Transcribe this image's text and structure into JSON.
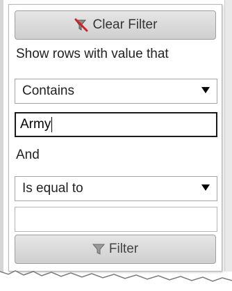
{
  "filter_menu": {
    "clear_filter_label": "Clear Filter",
    "clear_filter_icon": "clear-filter-icon",
    "instruction": "Show rows with value that",
    "first_condition": {
      "selected": "Contains"
    },
    "first_value": "Army",
    "logic_operator": "And",
    "second_condition": {
      "selected": "Is equal to"
    },
    "second_value": "",
    "filter_label": "Filter",
    "filter_icon": "funnel-icon"
  },
  "colors": {
    "clear_icon_red": "#d21f1f",
    "button_text": "#333333",
    "focus_border": "#1a1a1a"
  }
}
